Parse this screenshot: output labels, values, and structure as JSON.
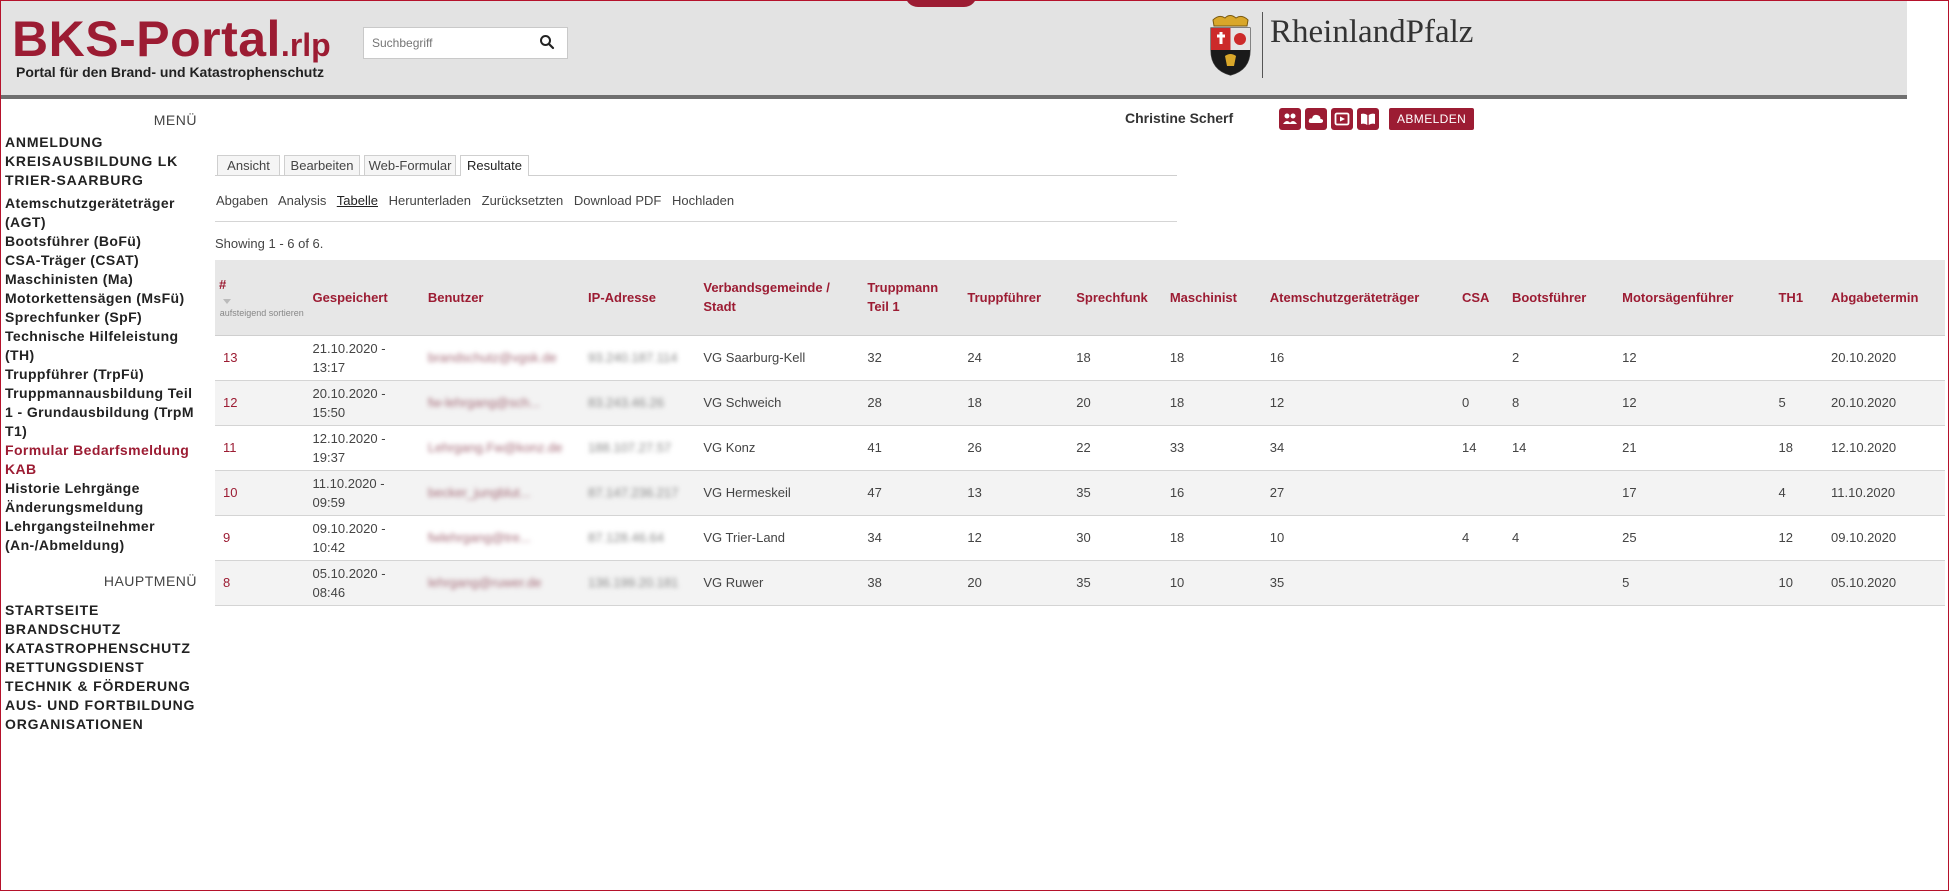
{
  "header": {
    "logo_main": "BKS-Portal",
    "logo_suffix": ".rlp",
    "tagline": "Portal für den Brand- und Katastrophenschutz",
    "search_placeholder": "Suchbegriff",
    "state_logo_text": "RheinlandPfalz"
  },
  "colors": {
    "brand": "#9c1c33",
    "header_bg": "#e3e3e3"
  },
  "sidebar": {
    "menu_heading": "MENÜ",
    "items": [
      "ANMELDUNG KREISAUSBILDUNG LK TRIER-SAARBURG",
      "Atemschutzgeräteträger (AGT)",
      "Bootsführer (BoFü)",
      "CSA-Träger (CSAT)",
      "Maschinisten (Ma)",
      "Motorkettensägen (MsFü)",
      "Sprechfunker (SpF)",
      "Technische Hilfeleistung (TH)",
      "Truppführer (TrpFü)",
      "Truppmannausbildung Teil 1 - Grundausbildung (TrpM T1)",
      "Formular Bedarfsmeldung KAB",
      "Historie Lehrgänge",
      "Änderungsmeldung",
      "Lehrgangsteilnehmer (An-/Abmeldung)"
    ],
    "main_heading": "HAUPTMENÜ",
    "main_items": [
      "STARTSEITE",
      "BRANDSCHUTZ",
      "KATASTROPHENSCHUTZ",
      "RETTUNGSDIENST",
      "TECHNIK & FÖRDERUNG",
      "AUS- UND FORTBILDUNG",
      "ORGANISATIONEN"
    ]
  },
  "user": {
    "name": "Christine Scherf",
    "icons": [
      "group-icon",
      "cloud-icon",
      "play-icon",
      "book-icon"
    ],
    "logout_label": "ABMELDEN"
  },
  "tabs": [
    "Ansicht",
    "Bearbeiten",
    "Web-Formular",
    "Resultate"
  ],
  "active_tab": "Resultate",
  "subtabs": [
    "Abgaben",
    "Analysis",
    "Tabelle",
    "Herunterladen",
    "Zurücksetzten",
    "Download PDF",
    "Hochladen"
  ],
  "active_subtab": "Tabelle",
  "showing_text": "Showing 1 - 6 of 6.",
  "table": {
    "sort_hint": "aufsteigend sortieren",
    "columns": [
      "#",
      "Gespeichert",
      "Benutzer",
      "IP-Adresse",
      "Verbandsgemeinde / Stadt",
      "Truppmann Teil 1",
      "Truppführer",
      "Sprechfunk",
      "Maschinist",
      "Atemschutzgeräteträger",
      "CSA",
      "Bootsführer",
      "Motorsägenführer",
      "TH1",
      "Abgabetermin"
    ],
    "rows": [
      [
        "13",
        "21.10.2020 - 13:17",
        "brandschutz@vgsk.de",
        "93.240.187.114",
        "VG Saarburg-Kell",
        "32",
        "24",
        "18",
        "18",
        "16",
        "",
        "2",
        "12",
        "",
        "20.10.2020"
      ],
      [
        "12",
        "20.10.2020 - 15:50",
        "fw-lehrgang@sch...",
        "83.243.46.26",
        "VG Schweich",
        "28",
        "18",
        "20",
        "18",
        "12",
        "0",
        "8",
        "12",
        "5",
        "20.10.2020"
      ],
      [
        "11",
        "12.10.2020 - 19:37",
        "Lehrgang.Fw@konz.de",
        "188.107.27.57",
        "VG Konz",
        "41",
        "26",
        "22",
        "33",
        "34",
        "14",
        "14",
        "21",
        "18",
        "12.10.2020"
      ],
      [
        "10",
        "11.10.2020 - 09:59",
        "becker_jungblut...",
        "87.147.236.217",
        "VG Hermeskeil",
        "47",
        "13",
        "35",
        "16",
        "27",
        "",
        "",
        "17",
        "4",
        "11.10.2020"
      ],
      [
        "9",
        "09.10.2020 - 10:42",
        "fwlehrgang@tre...",
        "87.128.46.64",
        "VG Trier-Land",
        "34",
        "12",
        "30",
        "18",
        "10",
        "4",
        "4",
        "25",
        "12",
        "09.10.2020"
      ],
      [
        "8",
        "05.10.2020 - 08:46",
        "lehrgang@ruwer.de",
        "136.199.20.181",
        "VG Ruwer",
        "38",
        "20",
        "35",
        "10",
        "35",
        "",
        "",
        "5",
        "10",
        "05.10.2020"
      ]
    ]
  }
}
